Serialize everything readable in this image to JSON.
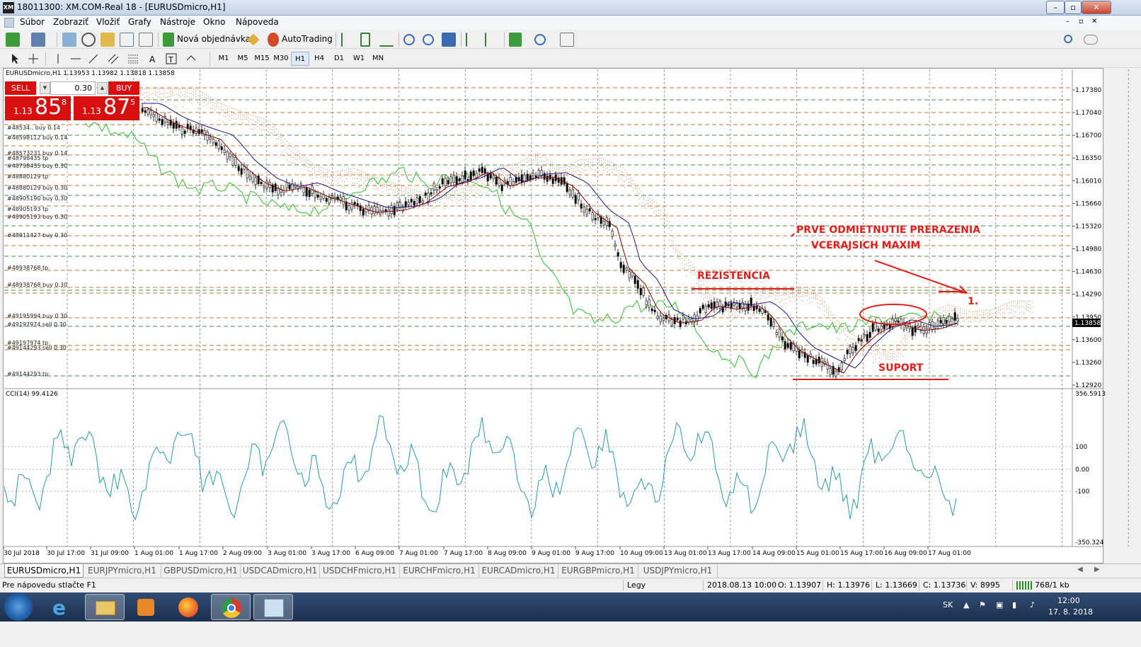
{
  "window": {
    "title": "18011300: XM.COM-Real 18 - [EURUSDmicro,H1]",
    "logo": "XM",
    "controls": [
      "–",
      "▫",
      "✕"
    ]
  },
  "menu": [
    "Súbor",
    "Zobraziť",
    "Vložiť",
    "Grafy",
    "Nástroje",
    "Okno",
    "Nápoveda"
  ],
  "toolbar": {
    "new_order_label": "Nová objednávka",
    "autotrading_label": "AutoTrading",
    "timeframes": [
      "M1",
      "M5",
      "M15",
      "M30",
      "H1",
      "H4",
      "D1",
      "W1",
      "MN"
    ],
    "active_timeframe": "H1"
  },
  "chart": {
    "symbol_info": "EURUSDmicro,H1  1.13953 1.13982 1.13818 1.13858",
    "trade_panel": {
      "sell_label": "SELL",
      "buy_label": "BUY",
      "lot": "0.30",
      "sell_prefix": "1.13",
      "sell_big": "85",
      "sell_sup": "8",
      "buy_prefix": "1.13",
      "buy_big": "87",
      "buy_sup": "5"
    },
    "price_axis": [
      "1.17380",
      "1.17040",
      "1.16700",
      "1.16350",
      "1.16010",
      "1.15660",
      "1.15320",
      "1.14980",
      "1.14630",
      "1.14290",
      "1.13950",
      "1.13600",
      "1.13260",
      "1.12920"
    ],
    "current_price": "1.13858",
    "order_labels": [
      "#48534.. buy 0.14",
      "#48598112 buy 0.14",
      "#48573231 buy 0.14",
      "#48798435 tp",
      "#48798435 buy 0.30",
      "#48880129 tp",
      "#48880129 buy 0.30",
      "#48905190 buy 0.30",
      "#48905193 tp",
      "#48905193 buy 0.30",
      "#48911427 buy 0.30",
      "#48938768 tp",
      "#48938768 buy 0.30",
      "#49195994 buy 0.30",
      "#49197974 sell 0.30",
      "#49197974 tp",
      "#49144293 sell 0.30",
      "#49144293 tp"
    ],
    "annotations": {
      "resistance": "REZISTENCIA",
      "support": "SUPORT",
      "note_line1": "PRVE ODMIETNUTIE PRERAZENIA",
      "note_line2": "VCERAJSICH MAXIM",
      "marker": "1."
    },
    "indicator": {
      "label": "CCI(14) 99.4126",
      "axis": [
        "356.5913",
        "100",
        "0.00",
        "-100",
        "-350.324"
      ]
    },
    "time_axis": [
      "30 Jul 2018",
      "30 Jul 17:00",
      "31 Jul 09:00",
      "1 Aug 01:00",
      "1 Aug 17:00",
      "2 Aug 09:00",
      "3 Aug 01:00",
      "3 Aug 17:00",
      "6 Aug 09:00",
      "7 Aug 01:00",
      "7 Aug 17:00",
      "8 Aug 09:00",
      "9 Aug 01:00",
      "9 Aug 17:00",
      "10 Aug 09:00",
      "13 Aug 01:00",
      "13 Aug 17:00",
      "14 Aug 09:00",
      "15 Aug 01:00",
      "15 Aug 17:00",
      "16 Aug 09:00",
      "17 Aug 01:00"
    ]
  },
  "tabs": [
    "EURUSDmicro,H1",
    "EURJPYmicro,H1",
    "GBPUSDmicro,H1",
    "USDCADmicro,H1",
    "USDCHFmicro,H1",
    "EURCHFmicro,H1",
    "EURCADmicro,H1",
    "EURGBPmicro,H1",
    "USDJPYmicro,H1"
  ],
  "status": {
    "help": "Pre nápovedu stlačte F1",
    "profile": "Legy",
    "datetime": "2018.08.13 10:00",
    "open": "O: 1.13907",
    "high": "H: 1.13976",
    "low": "L: 1.13669",
    "close": "C: 1.13736",
    "volume": "V: 8995",
    "traffic": "768/1 kb"
  },
  "taskbar": {
    "lang": "SK",
    "time": "12:00",
    "date": "17. 8. 2018"
  },
  "colors": {
    "sell_red": "#d80f0f",
    "annotation_red": "#e0201c",
    "kijun": "#8b0000",
    "tenkan_blue": "#1a1a8c",
    "chikou_green": "#2fbf2f",
    "cloud_brown": "#d2a07a",
    "cci_line": "#2a9aa8",
    "order_line_green": "#4c8c4c",
    "order_line_brown": "#c27a3a"
  }
}
